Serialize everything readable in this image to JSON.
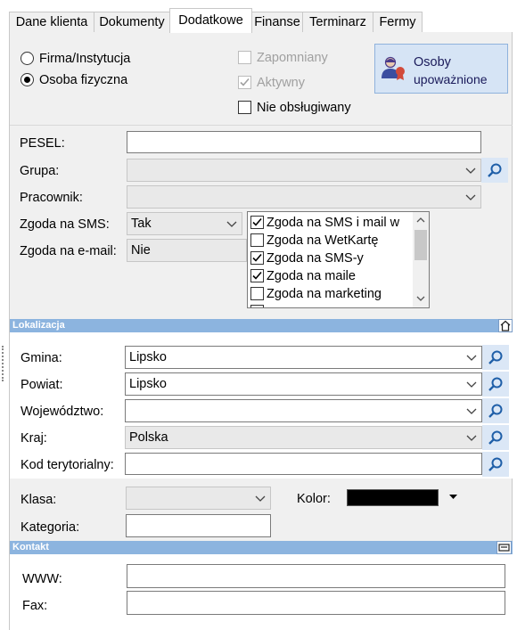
{
  "tabs": [
    "Dane klienta",
    "Dokumenty",
    "Dodatkowe",
    "Finanse",
    "Terminarz",
    "Fermy"
  ],
  "active_tab": "Dodatkowe",
  "entity_type": {
    "options": [
      "Firma/Instytucja",
      "Osoba fizyczna"
    ],
    "selected": "Osoba fizyczna"
  },
  "flags": {
    "zapomniany": {
      "label": "Zapomniany",
      "checked": false,
      "disabled": true
    },
    "aktywny": {
      "label": "Aktywny",
      "checked": true,
      "disabled": true
    },
    "nieobslugiwany": {
      "label": "Nie obsługiwany",
      "checked": false,
      "disabled": false
    }
  },
  "authorized_button": {
    "line1": "Osoby",
    "line2": "upoważnione"
  },
  "fields": {
    "pesel": {
      "label": "PESEL:",
      "value": ""
    },
    "grupa": {
      "label": "Grupa:",
      "value": ""
    },
    "pracownik": {
      "label": "Pracownik:",
      "value": ""
    },
    "zgoda_sms": {
      "label": "Zgoda na SMS:",
      "value": "Tak"
    },
    "zgoda_email": {
      "label": "Zgoda na e-mail:",
      "value": "Nie"
    }
  },
  "consents": [
    {
      "label": "Zgoda na SMS i mail w",
      "checked": true
    },
    {
      "label": "Zgoda na WetKartę",
      "checked": false
    },
    {
      "label": "Zgoda na SMS-y",
      "checked": true
    },
    {
      "label": "Zgoda na maile",
      "checked": true
    },
    {
      "label": "Zgoda na marketing",
      "checked": false
    }
  ],
  "location": {
    "title": "Lokalizacja",
    "gmina": {
      "label": "Gmina:",
      "value": "Lipsko"
    },
    "powiat": {
      "label": "Powiat:",
      "value": "Lipsko"
    },
    "wojewodztwo": {
      "label": "Województwo:",
      "value": ""
    },
    "kraj": {
      "label": "Kraj:",
      "value": "Polska"
    },
    "kod": {
      "label": "Kod terytorialny:",
      "value": ""
    }
  },
  "misc": {
    "klasa": {
      "label": "Klasa:",
      "value": ""
    },
    "kolor": {
      "label": "Kolor:",
      "value": "#000000"
    },
    "kategoria": {
      "label": "Kategoria:",
      "value": ""
    }
  },
  "contact": {
    "title": "Kontakt",
    "www": {
      "label": "WWW:",
      "value": ""
    },
    "fax": {
      "label": "Fax:",
      "value": ""
    }
  }
}
